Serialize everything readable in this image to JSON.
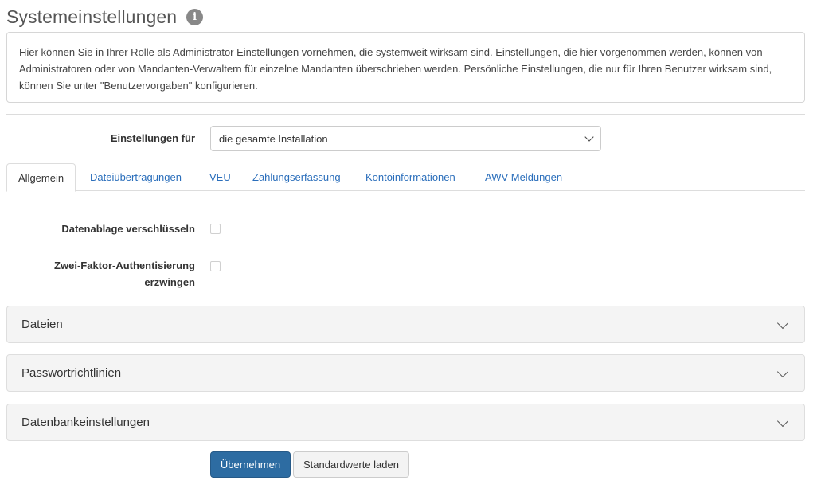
{
  "header": {
    "title": "Systemeinstellungen",
    "info_icon": "info-icon",
    "info_glyph": "i"
  },
  "intro": {
    "text": "Hier können Sie in Ihrer Rolle als Administrator Einstellungen vornehmen, die systemweit wirksam sind. Einstellungen, die hier vorgenommen werden, können von Administratoren oder von Mandanten-Verwaltern für einzelne Mandanten überschrieben werden. Persönliche Einstellungen, die nur für Ihren Benutzer wirksam sind, können Sie unter \"Benutzervorgaben\" konfigurieren."
  },
  "scope": {
    "label": "Einstellungen für",
    "selected": "die gesamte Installation",
    "icon": "chevron-down-icon"
  },
  "tabs": [
    {
      "label": "Allgemein",
      "active": true
    },
    {
      "label": "Dateiübertragungen",
      "active": false
    },
    {
      "label": "VEU",
      "active": false
    },
    {
      "label": "Zahlungserfassung",
      "active": false
    },
    {
      "label": "Kontoinformationen",
      "active": false
    },
    {
      "label": "AWV-Meldungen",
      "active": false
    }
  ],
  "fields": [
    {
      "label": "Datenablage verschlüsseln",
      "checked": false
    },
    {
      "label_line1": "Zwei-Faktor-Authentisierung",
      "label_line2": "erzwingen",
      "checked": false
    }
  ],
  "panels": [
    {
      "title": "Dateien",
      "icon": "chevron-down-icon",
      "expanded": false
    },
    {
      "title": "Passwortrichtlinien",
      "icon": "chevron-down-icon",
      "expanded": false
    },
    {
      "title": "Datenbankeinstellungen",
      "icon": "chevron-down-icon",
      "expanded": false
    }
  ],
  "actions": {
    "apply_label": "Übernehmen",
    "defaults_label": "Standardwerte laden"
  },
  "colors": {
    "primary": "#2d6ca2",
    "link": "#2a6ebb",
    "panel_bg": "#f4f4f4"
  }
}
